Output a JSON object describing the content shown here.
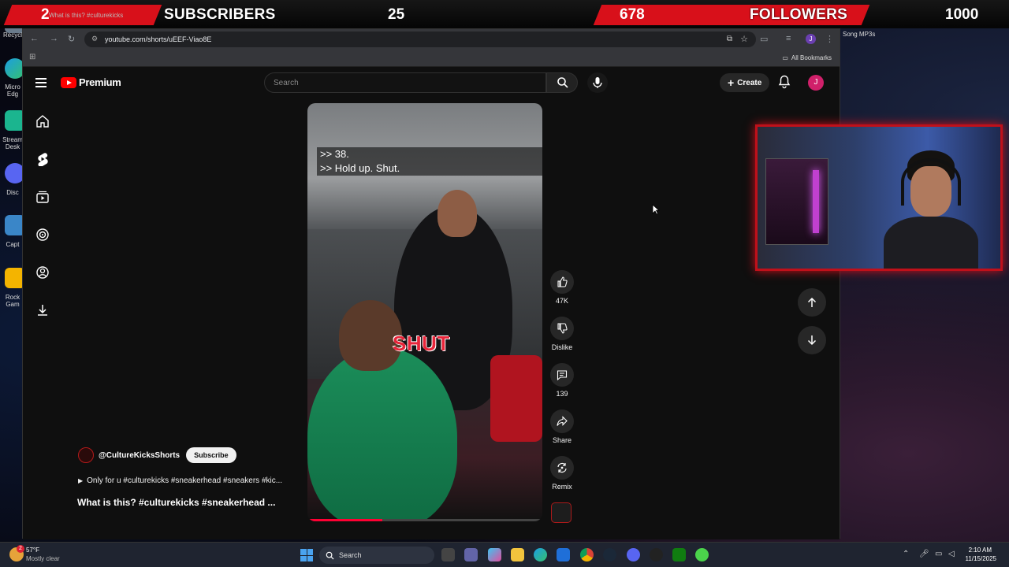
{
  "overlay": {
    "left_count": "2",
    "subscribers_label": "SUBSCRIBERS",
    "subscribers_goal": "25",
    "followers_count": "678",
    "followers_label": "FOLLOWERS",
    "followers_goal": "1000",
    "accent": "#d8101a"
  },
  "desktop": {
    "icons": [
      "Recycl",
      "Micro Edg",
      "Stream Desk",
      "Disc",
      "Capt",
      "Rock Gam"
    ],
    "right_label": "Song MP3s"
  },
  "browser": {
    "tab_title": "What is this? #culturekicks",
    "url": "youtube.com/shorts/uEEF-Viao8E",
    "all_bookmarks": "All Bookmarks",
    "profile_initial": "J"
  },
  "youtube": {
    "logo_text": "Premium",
    "search_placeholder": "Search",
    "create_label": "Create",
    "avatar_initial": "J",
    "avatar_color": "#d0206a"
  },
  "short": {
    "caption_line1": ">> 38.",
    "caption_line2": ">> Hold up. Shut.",
    "overlay_word": "SHUT",
    "channel": "@CultureKicksShorts",
    "subscribe_label": "Subscribe",
    "description": "Only for u #culturekicks #sneakerhead #sneakers #kic...",
    "title": "What is this? #culturekicks #sneakerhead ..."
  },
  "actions": {
    "like_count": "47K",
    "dislike_label": "Dislike",
    "comment_count": "139",
    "share_label": "Share",
    "remix_label": "Remix"
  },
  "taskbar": {
    "temperature": "57°F",
    "weather": "Mostly clear",
    "weather_badge": "2",
    "search_label": "Search",
    "time": "2:10 AM",
    "date": "11/15/2025"
  }
}
